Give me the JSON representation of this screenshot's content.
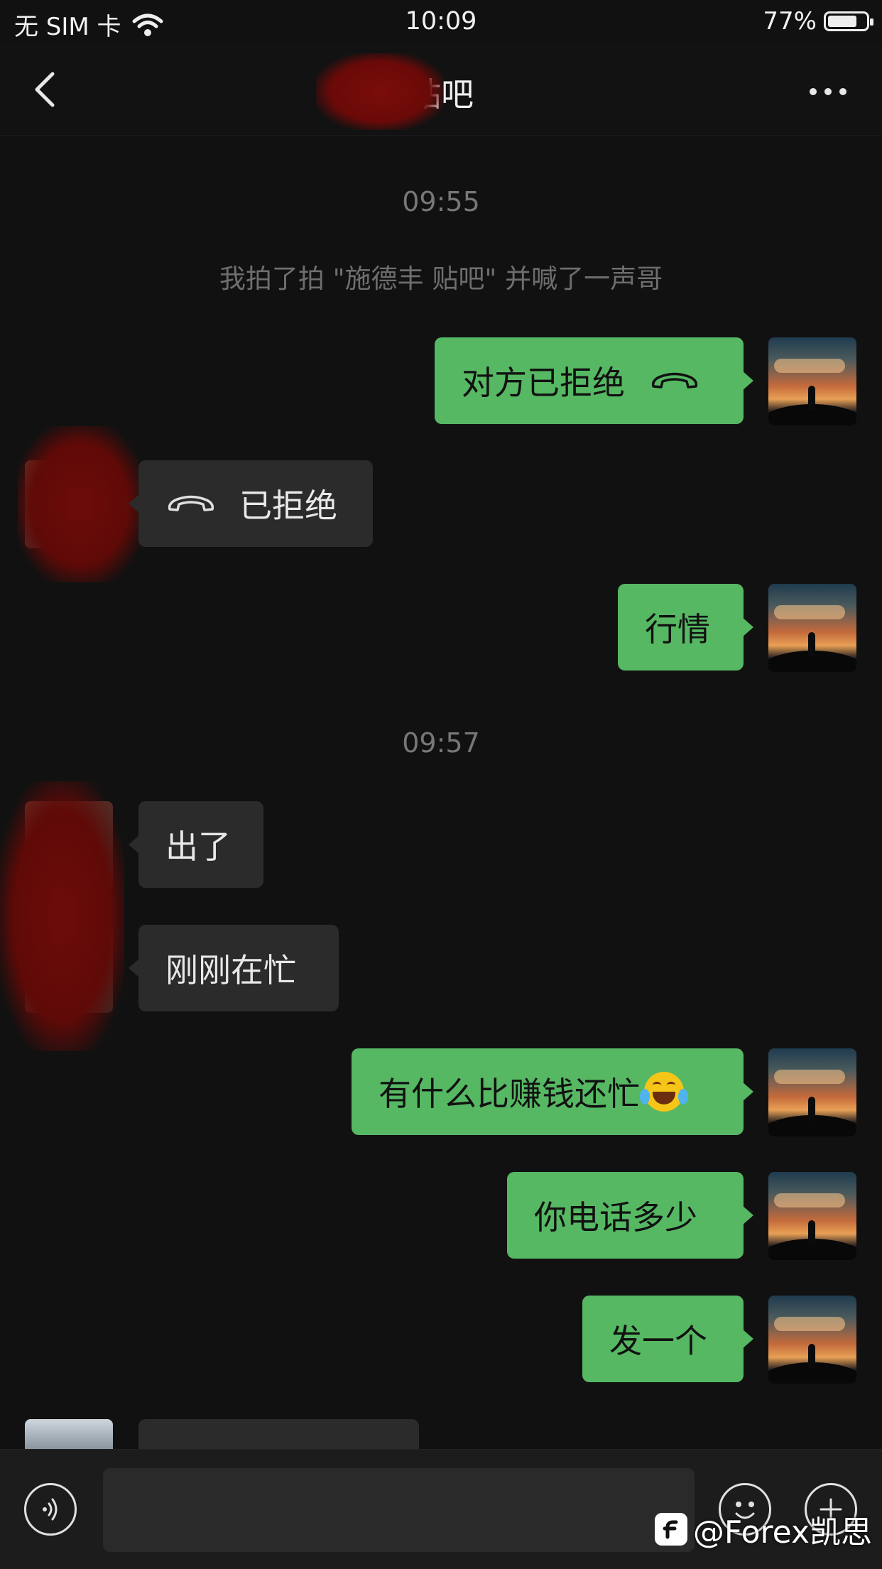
{
  "status_bar": {
    "carrier": "无 SIM 卡",
    "time": "10:09",
    "battery": "77%",
    "battery_level": 0.77
  },
  "nav": {
    "title": "贴吧",
    "back_icon": "chevron-left-icon",
    "more_icon": "more-dots-icon"
  },
  "chat": {
    "timestamp_1": "09:55",
    "system_message": "我拍了拍 \"施德丰 贴吧\" 并喊了一声哥",
    "msg_call_out": "对方已拒绝",
    "msg_call_in": "已拒绝",
    "msg_market": "行情",
    "timestamp_2": "09:57",
    "msg_out_1": "出了",
    "msg_busy": "刚刚在忙",
    "msg_money": "有什么比赚钱还忙",
    "msg_phone": "你电话多少",
    "msg_send": "发一个"
  },
  "input_bar": {
    "voice_icon": "voice-icon",
    "emoji_icon": "emoji-icon",
    "add_icon": "add-icon"
  },
  "watermark": {
    "text": "@Forex凯思"
  },
  "colors": {
    "sent_bubble": "#56b863",
    "received_bubble": "#2b2b2b",
    "background": "#111111"
  }
}
